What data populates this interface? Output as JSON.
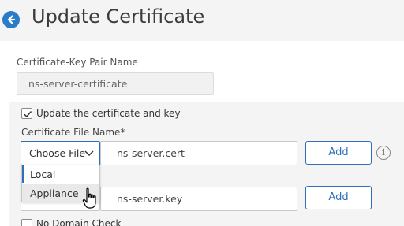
{
  "header": {
    "title": "Update Certificate"
  },
  "form": {
    "cert_key_pair_label": "Certificate-Key Pair Name",
    "cert_key_pair_value": "ns-server-certificate",
    "update_checkbox_label": "Update the certificate and key",
    "update_checked": true,
    "cert_file_label": "Certificate File Name*",
    "choose_file_label": "Choose File",
    "cert_file_value": "ns-server.cert",
    "key_file_value": "ns-server.key",
    "add_label": "Add",
    "no_domain_check_label": "No Domain Check"
  },
  "dropdown": {
    "options": [
      "Local",
      "Appliance"
    ],
    "hovered": "Appliance"
  },
  "colors": {
    "accent": "#2d6fb8",
    "back_button": "#2b7bc9"
  }
}
